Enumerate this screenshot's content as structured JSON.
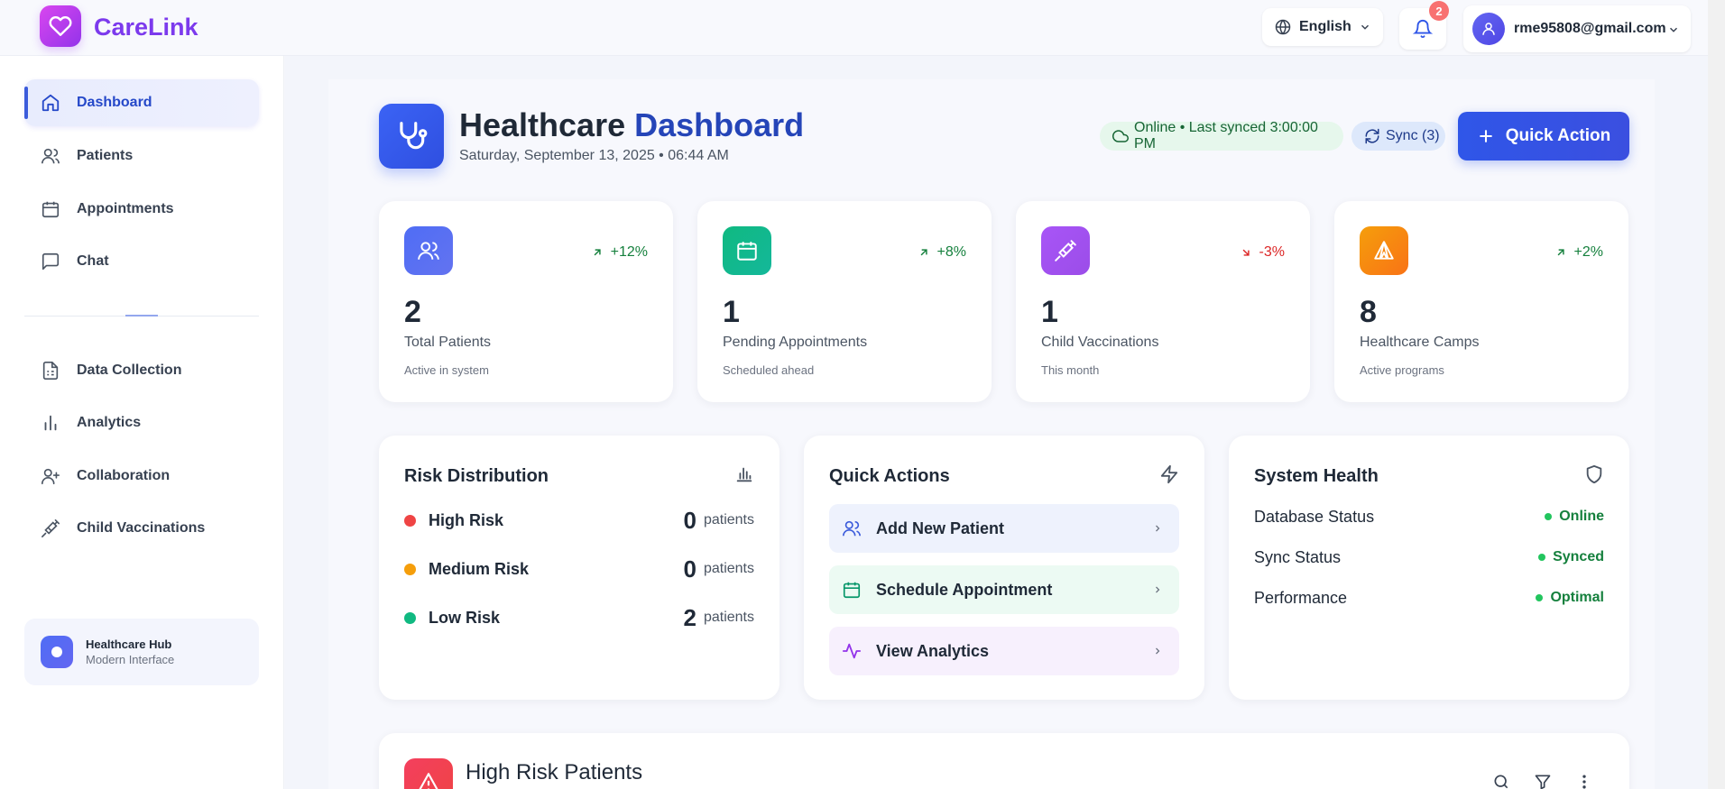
{
  "app": {
    "name": "CareLink",
    "accent": "#7c3aed",
    "logo_icon": "heart-icon"
  },
  "topbar": {
    "language": "English",
    "notification_count": "2",
    "user_email": "rme95808@gmail.com"
  },
  "sidebar": {
    "items": [
      {
        "label": "Dashboard",
        "icon": "home-icon",
        "active": true
      },
      {
        "label": "Patients",
        "icon": "users-icon"
      },
      {
        "label": "Appointments",
        "icon": "calendar-icon"
      },
      {
        "label": "Chat",
        "icon": "message-icon"
      },
      {
        "label": "Data Collection",
        "icon": "document-icon"
      },
      {
        "label": "Analytics",
        "icon": "bar-chart-icon"
      },
      {
        "label": "Collaboration",
        "icon": "user-plus-icon"
      },
      {
        "label": "Child Vaccinations",
        "icon": "syringe-icon"
      }
    ],
    "hub": {
      "title": "Healthcare Hub",
      "subtitle": "Modern Interface"
    }
  },
  "header": {
    "title_part1": "Healthcare",
    "title_part2": "Dashboard",
    "date": "Saturday, September 13, 2025 • 06:44 AM",
    "status": "Online • Last synced 3:00:00 PM",
    "sync": "Sync (3)",
    "quick_action": "Quick Action"
  },
  "stats": [
    {
      "value": "2",
      "label": "Total Patients",
      "sub": "Active in system",
      "trend": "+12%",
      "trend_dir": "up",
      "color": "#4f6df5",
      "icon": "users-icon"
    },
    {
      "value": "1",
      "label": "Pending Appointments",
      "sub": "Scheduled ahead",
      "trend": "+8%",
      "trend_dir": "up",
      "color": "#10b981",
      "icon": "calendar-icon"
    },
    {
      "value": "1",
      "label": "Child Vaccinations",
      "sub": "This month",
      "trend": "-3%",
      "trend_dir": "down",
      "color": "#a855f7",
      "icon": "syringe-icon"
    },
    {
      "value": "8",
      "label": "Healthcare Camps",
      "sub": "Active programs",
      "trend": "+2%",
      "trend_dir": "up",
      "color": "#f59e0b",
      "icon": "tent-icon"
    }
  ],
  "risk": {
    "title": "Risk Distribution",
    "unit": "patients",
    "rows": [
      {
        "label": "High Risk",
        "count": "0",
        "color": "#ef4444"
      },
      {
        "label": "Medium Risk",
        "count": "0",
        "color": "#f59e0b"
      },
      {
        "label": "Low Risk",
        "count": "2",
        "color": "#10b981"
      }
    ]
  },
  "quick_actions": {
    "title": "Quick Actions",
    "items": [
      {
        "label": "Add New Patient",
        "icon": "users-icon"
      },
      {
        "label": "Schedule Appointment",
        "icon": "calendar-icon"
      },
      {
        "label": "View Analytics",
        "icon": "activity-icon"
      }
    ]
  },
  "system_health": {
    "title": "System Health",
    "rows": [
      {
        "label": "Database Status",
        "value": "Online"
      },
      {
        "label": "Sync Status",
        "value": "Synced"
      },
      {
        "label": "Performance",
        "value": "Optimal"
      }
    ]
  },
  "high_risk": {
    "title": "High Risk Patients"
  }
}
